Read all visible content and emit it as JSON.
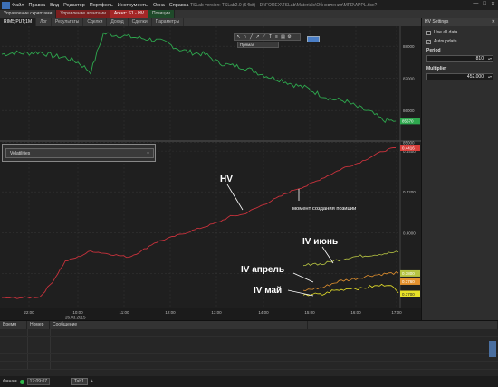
{
  "window": {
    "title": "TSLab version: TSLab2.0 (64bit) - D:\\FOREX\\TSLab\\Materials\\Обновления\\MFD\\APPL.tlsx?",
    "menu": [
      "Файл",
      "Правка",
      "Вид",
      "Редактор",
      "Портфель",
      "Инструменты",
      "Окна",
      "Справка"
    ],
    "controls": [
      "—",
      "□",
      "✕"
    ]
  },
  "top_tabs": [
    "Управление скриптами",
    "Управление агентами",
    "Агент: S1 - HV",
    "Позиции"
  ],
  "sub_tabs": [
    "RIM5;PUT;1M",
    "Лог",
    "Результаты",
    "Сделки",
    "Доход",
    "Сделки",
    "Параметры"
  ],
  "drawing_toolbar": {
    "icons": [
      "pointer-icon",
      "magnet-icon",
      "line-icon",
      "ray-icon",
      "segment-icon",
      "text-icon",
      "fibo-icon",
      "channel-icon",
      "settings-icon"
    ],
    "line_type": "Прямая"
  },
  "volatility_panel": {
    "selected": "Volatilities"
  },
  "settings_panel": {
    "title": "HV Settings",
    "use_all_data_label": "Use all data",
    "use_all_data": false,
    "autoupdate_label": "Autoupdate",
    "autoupdate": true,
    "period_label": "Period",
    "period_value": "810",
    "multiplier_label": "Multiplier",
    "multiplier_value": "452.000"
  },
  "log_panel": {
    "columns": [
      "Время",
      "Номер",
      "Сообщение"
    ],
    "row_count": 5
  },
  "status_bar": {
    "mode": "Финам",
    "time": "17:09:07",
    "workspace": "Tab1"
  },
  "colors": {
    "price": "#2ea84e",
    "hv": "#c8323c",
    "iv_june": "#b7c442",
    "iv_april": "#e2902e",
    "iv_may": "#e8e229",
    "price_marker": "#2ea84e",
    "hv_marker": "#d9403c"
  },
  "chart_data": [
    {
      "type": "line",
      "name": "price",
      "y_axis_labels": [
        "88000",
        "87000",
        "86000",
        "85000"
      ],
      "last_value_label": "85670",
      "series": [
        {
          "values": [
            87750,
            87800,
            87780,
            87820,
            87700,
            87650,
            87500,
            87200,
            88400,
            88350,
            88300,
            88250,
            88200,
            88100,
            87900,
            87800,
            87750,
            87500,
            87400,
            87350,
            87200,
            87050,
            86950,
            86800,
            86700,
            86500,
            86350,
            86300,
            86100,
            85950,
            85700,
            85670
          ]
        }
      ]
    },
    {
      "type": "line",
      "name": "volatility",
      "y_axis_labels": [
        "0.4400",
        "0.4200",
        "0.4000",
        "0.3800"
      ],
      "markers": [
        "0.4416",
        "0.3800",
        "0.3760",
        "0.3700"
      ],
      "x_labels": [
        "22:00",
        "10:00",
        "11:00",
        "12:00",
        "13:00",
        "14:00",
        "15:00",
        "16:00",
        "17:00"
      ],
      "date_label": "26.03.2015",
      "annotations": {
        "hv": "HV",
        "position": "момент создания позиции",
        "iv_june": "IV июнь",
        "iv_april": "IV апрель",
        "iv_may": "IV май"
      },
      "series": [
        {
          "values": [
            0.368,
            0.368,
            0.3682,
            0.3685,
            0.376,
            0.386,
            0.388,
            0.391,
            0.39,
            0.389,
            0.388,
            0.391,
            0.395,
            0.397,
            0.399,
            0.401,
            0.403,
            0.405,
            0.408,
            0.409,
            0.412,
            0.415,
            0.418,
            0.421,
            0.423,
            0.426,
            0.429,
            0.432,
            0.434,
            0.437,
            0.44,
            0.4416
          ]
        },
        {
          "values": [
            0.3835,
            0.385,
            0.3845,
            0.386,
            0.387,
            0.388,
            0.3885,
            0.389,
            0.3895,
            0.39,
            0.3905
          ]
        },
        {
          "values": [
            0.3715,
            0.3725,
            0.373,
            0.375,
            0.3765,
            0.377,
            0.378,
            0.379,
            0.3795,
            0.38,
            0.3802
          ]
        },
        {
          "values": [
            0.369,
            0.37,
            0.3695,
            0.3715,
            0.372,
            0.373,
            0.3725,
            0.3735,
            0.374,
            0.3748,
            0.3705
          ]
        }
      ]
    }
  ]
}
